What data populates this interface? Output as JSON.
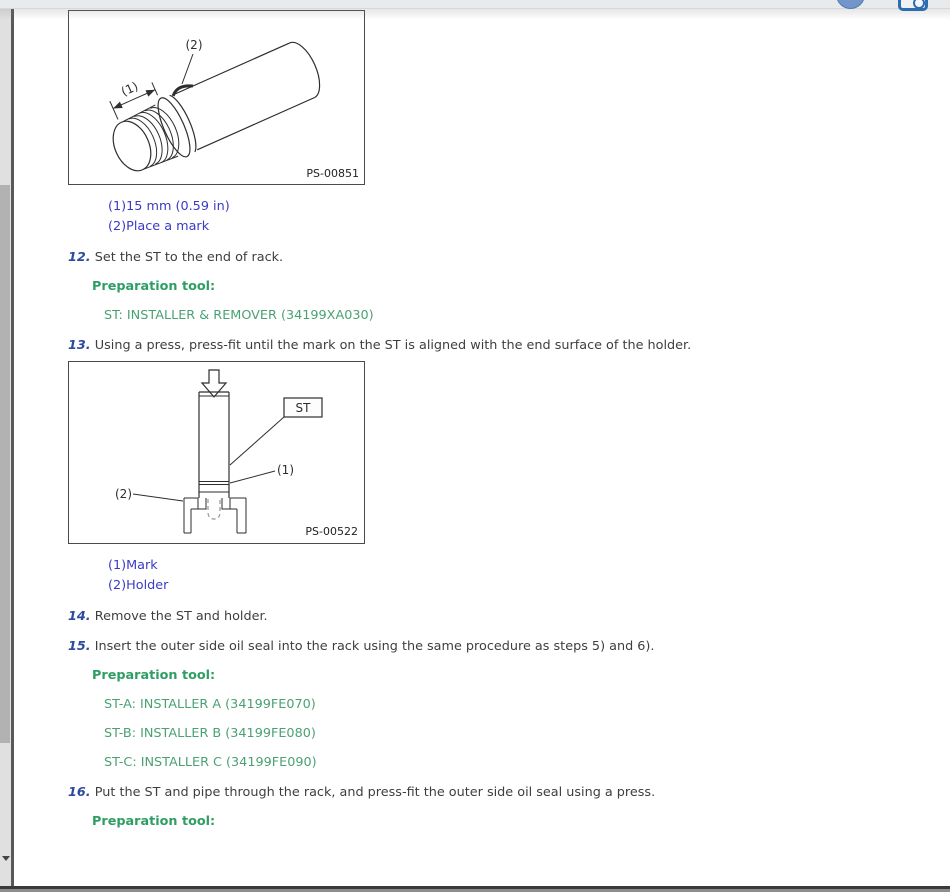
{
  "toolbar": {
    "icons": [
      {
        "name": "profile-circle-icon"
      },
      {
        "name": "magnifier-tool-icon"
      }
    ]
  },
  "figures": {
    "fig1": {
      "code": "PS-00851",
      "callout_1": "(1)",
      "callout_2": "(2)"
    },
    "fig2": {
      "code": "PS-00522",
      "label_st": "ST",
      "callout_1": "(1)",
      "callout_2": "(2)"
    }
  },
  "content": {
    "fig1_captions": {
      "line1": "(1)15 mm (0.59 in)",
      "line2": "(2)Place a mark"
    },
    "fig2_captions": {
      "line1": "(1)Mark",
      "line2": "(2)Holder"
    },
    "prep_label": "Preparation tool:",
    "steps": {
      "s12": {
        "num": "12.",
        "text": "Set the ST to the end of rack."
      },
      "s13": {
        "num": "13.",
        "text": "Using a press, press-fit until the mark on the ST is aligned with the end surface of the holder."
      },
      "s14": {
        "num": "14.",
        "text": "Remove the ST and holder."
      },
      "s15": {
        "num": "15.",
        "text": "Insert the outer side oil seal into the rack using the same procedure as steps 5) and 6)."
      },
      "s16": {
        "num": "16.",
        "text": "Put the ST and pipe through the rack, and press-fit the outer side oil seal using a press."
      }
    },
    "tools": {
      "st": "ST: INSTALLER & REMOVER (34199XA030)",
      "sta": "ST-A: INSTALLER A (34199FE070)",
      "stb": "ST-B: INSTALLER B (34199FE080)",
      "stc": "ST-C: INSTALLER C (34199FE090)"
    }
  },
  "colors": {
    "caption_blue": "#3a3ac8",
    "step_number_blue": "#2c4a9e",
    "prep_green_bold": "#2f9e63",
    "tool_green": "#4aa173"
  }
}
